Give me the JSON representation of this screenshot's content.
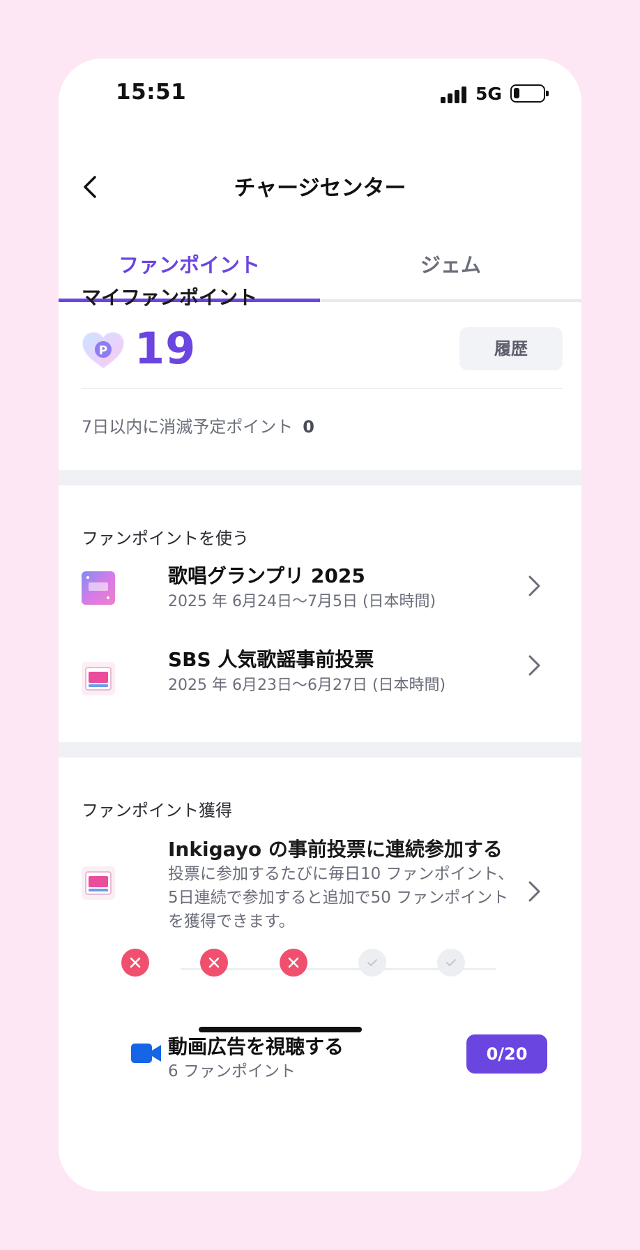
{
  "status_bar": {
    "time": "15:51",
    "network": "5G",
    "battery_level": 0.2
  },
  "header": {
    "title": "チャージセンター"
  },
  "tabs": [
    {
      "label": "ファンポイント",
      "active": true
    },
    {
      "label": "ジェム",
      "active": false
    }
  ],
  "my_points": {
    "title": "マイファンポイント",
    "value": "19",
    "history_label": "履歴",
    "expire_label": "7日以内に消滅予定ポイント",
    "expire_value": "0"
  },
  "use_section": {
    "title": "ファンポイントを使う",
    "items": [
      {
        "title": "歌唱グランプリ 2025",
        "date": "2025 年 6月24日〜7月5日 (日本時間)"
      },
      {
        "title": "SBS 人気歌謡事前投票",
        "date": "2025 年 6月23日〜6月27日 (日本時間)"
      }
    ]
  },
  "earn_section": {
    "title": "ファンポイント獲得",
    "mission_title": "Inkigayo の事前投票に連続参加する",
    "mission_desc": "投票に参加するたびに毎日10 ファンポイント、5日連続で参加すると追加で50 ファンポイントを獲得できます。",
    "progress": [
      "fail",
      "fail",
      "fail",
      "pending",
      "pending"
    ],
    "ad_title": "動画広告を視聴する",
    "ad_sub": "6 ファンポイント",
    "ad_count": "0/20"
  },
  "colors": {
    "accent": "#6b45e0",
    "fail": "#f0506e",
    "background": "#fde7f4"
  }
}
